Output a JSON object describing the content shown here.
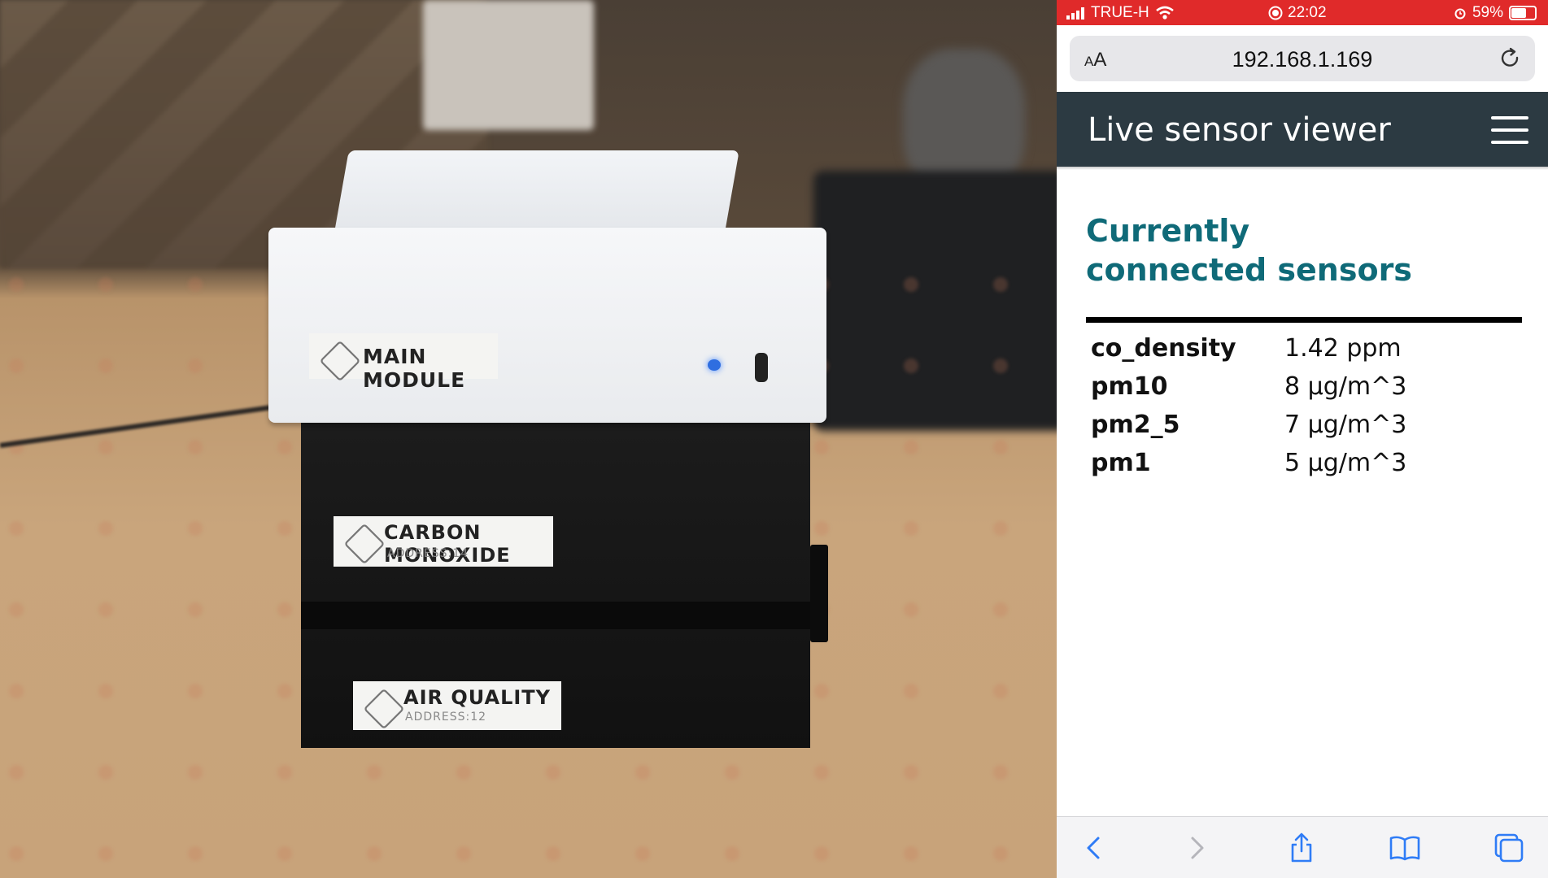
{
  "photo": {
    "labels": {
      "main": "MAIN MODULE",
      "co_title": "CARBON MONOXIDE",
      "co_address": "ADDRESS:14",
      "aq_title": "AIR QUALITY",
      "aq_address": "ADDRESS:12"
    },
    "colors": {
      "led": "#2f6ee0"
    }
  },
  "statusbar": {
    "carrier": "TRUE-H",
    "time": "22:02",
    "battery": "59%",
    "battery_level": 0.59,
    "background": "#e02a2a"
  },
  "browser": {
    "text_size_button": "AA",
    "url": "192.168.1.169",
    "reload_icon": "reload-icon"
  },
  "navbar": {
    "title": "Live sensor viewer",
    "menu_icon": "hamburger-icon",
    "background": "#2c3a42"
  },
  "main": {
    "heading": "Currently connected sensors",
    "heading_color": "#0f6a78",
    "sensors": [
      {
        "name": "co_density",
        "value": "1.42 ppm"
      },
      {
        "name": "pm10",
        "value": "8 µg/m^3"
      },
      {
        "name": "pm2_5",
        "value": "7 µg/m^3"
      },
      {
        "name": "pm1",
        "value": "5 µg/m^3"
      }
    ]
  },
  "toolbar": {
    "buttons": [
      "back-icon",
      "forward-icon",
      "share-icon",
      "bookmarks-icon",
      "tabs-icon"
    ],
    "accent": "#2f7cf6"
  }
}
